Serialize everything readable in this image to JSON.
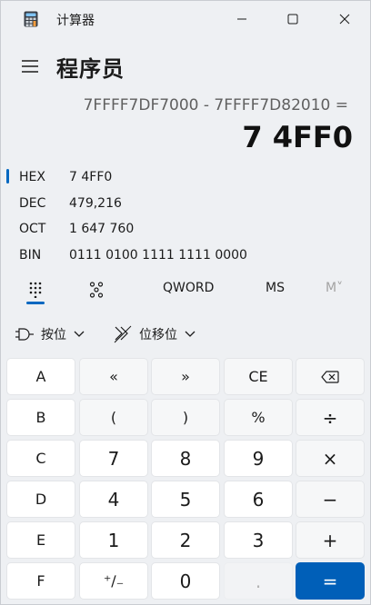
{
  "window": {
    "title": "计算器",
    "icon": "calculator-icon"
  },
  "header": {
    "mode_title": "程序员",
    "menu_icon": "hamburger-menu-icon"
  },
  "display": {
    "expression": "7FFFF7DF7000 - 7FFFF7D82010 =",
    "result": "7 4FF0"
  },
  "radix": [
    {
      "label": "HEX",
      "value": "7 4FF0",
      "selected": true
    },
    {
      "label": "DEC",
      "value": "479,216",
      "selected": false
    },
    {
      "label": "OCT",
      "value": "1 647 760",
      "selected": false
    },
    {
      "label": "BIN",
      "value": "0111 0100 1111 1111 0000",
      "selected": false
    }
  ],
  "tabs": {
    "keypad_icon": "full-keypad-icon",
    "bit_toggle_icon": "bit-toggle-keypad-icon",
    "word_size": "QWORD",
    "memory_store": "MS",
    "memory_list": "M˅"
  },
  "operations": {
    "bitwise_label": "按位",
    "bitshift_label": "位移位"
  },
  "keys": {
    "row1": [
      "A",
      "«",
      "»",
      "CE",
      "⌫"
    ],
    "row2": [
      "B",
      "(",
      ")",
      "%",
      "÷"
    ],
    "row3": [
      "C",
      "7",
      "8",
      "9",
      "×"
    ],
    "row4": [
      "D",
      "4",
      "5",
      "6",
      "−"
    ],
    "row5": [
      "E",
      "1",
      "2",
      "3",
      "+"
    ],
    "row6": [
      "F",
      "⁺∕₋",
      "0",
      ".",
      "="
    ]
  },
  "colors": {
    "accent": "#0067c0",
    "equals_bg": "#005fb8",
    "background": "#eef0f3"
  }
}
